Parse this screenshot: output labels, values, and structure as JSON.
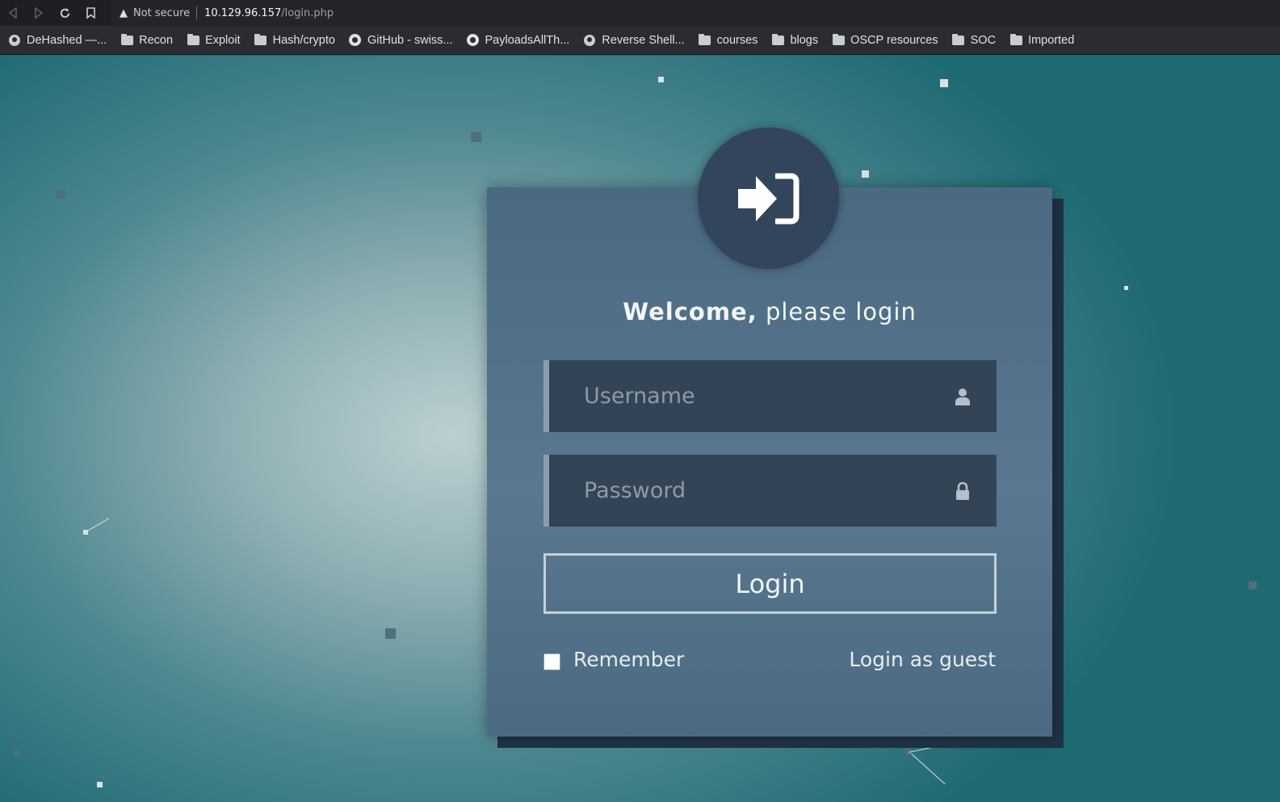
{
  "browser": {
    "security_label": "Not secure",
    "url_host": "10.129.96.157",
    "url_path": "/login.php"
  },
  "bookmarks": [
    {
      "label": "DeHashed —...",
      "icon": "globe-icon"
    },
    {
      "label": "Recon",
      "icon": "folder-icon"
    },
    {
      "label": "Exploit",
      "icon": "folder-icon"
    },
    {
      "label": "Hash/crypto",
      "icon": "folder-icon"
    },
    {
      "label": "GitHub - swiss...",
      "icon": "github-icon"
    },
    {
      "label": "PayloadsAllTh...",
      "icon": "github-icon"
    },
    {
      "label": "Reverse Shell...",
      "icon": "globe-icon"
    },
    {
      "label": "courses",
      "icon": "folder-icon"
    },
    {
      "label": "blogs",
      "icon": "folder-icon"
    },
    {
      "label": "OSCP resources",
      "icon": "folder-icon"
    },
    {
      "label": "SOC",
      "icon": "folder-icon"
    },
    {
      "label": "Imported",
      "icon": "folder-icon"
    }
  ],
  "login": {
    "welcome_bold": "Welcome,",
    "welcome_rest": " please login",
    "username_placeholder": "Username",
    "password_placeholder": "Password",
    "login_button": "Login",
    "remember_label": "Remember",
    "guest_link": "Login as guest"
  },
  "colors": {
    "card": "#4a6a82",
    "field": "#334457",
    "avatar": "#33455a"
  }
}
